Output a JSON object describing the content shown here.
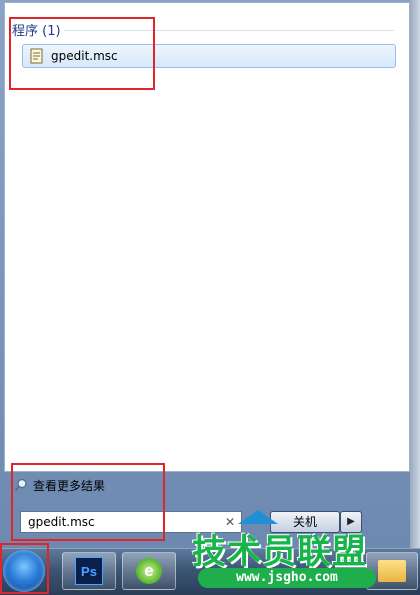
{
  "results": {
    "section_header": "程序 (1)",
    "items": [
      {
        "label": "gpedit.msc",
        "icon": "document-icon"
      }
    ]
  },
  "more_results": {
    "label": "查看更多结果",
    "icon": "search-icon"
  },
  "search": {
    "value": "gpedit.msc",
    "clear_icon": "close-icon"
  },
  "shutdown": {
    "label": "关机",
    "arrow_icon": "chevron-right-icon"
  },
  "taskbar": {
    "start_icon": "windows-orb-icon",
    "apps": [
      {
        "name": "Photoshop",
        "icon_text": "Ps"
      },
      {
        "name": "Internet Explorer",
        "icon_text": "e"
      },
      {
        "name": "Explorer",
        "icon": "folder-icon"
      }
    ]
  },
  "watermark": {
    "title": "技术员联盟",
    "url": "www.jsgho.com"
  },
  "colors": {
    "highlight": "#e0262b",
    "selection_border": "#9bbee8",
    "watermark_green": "#16b54a"
  }
}
